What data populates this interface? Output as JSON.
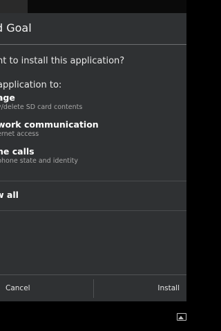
{
  "dialog": {
    "title": "d Goal",
    "question": "nt to install this application?",
    "section_header": "application to:",
    "permissions": [
      {
        "title": "age",
        "description": "y/delete SD card contents"
      },
      {
        "title": "work communication",
        "description": "ernet access"
      },
      {
        "title": "ne calls",
        "description": "phone state and identity"
      }
    ],
    "show_all": "w all",
    "buttons": {
      "cancel": "Cancel",
      "install": "Install"
    }
  },
  "colors": {
    "dialog_background": "#2f3133",
    "screen_background": "#000000",
    "title_text": "#f2f2f2",
    "secondary_text": "#a8a8a8"
  },
  "icons": {
    "nav_right": "screenshot-icon"
  }
}
